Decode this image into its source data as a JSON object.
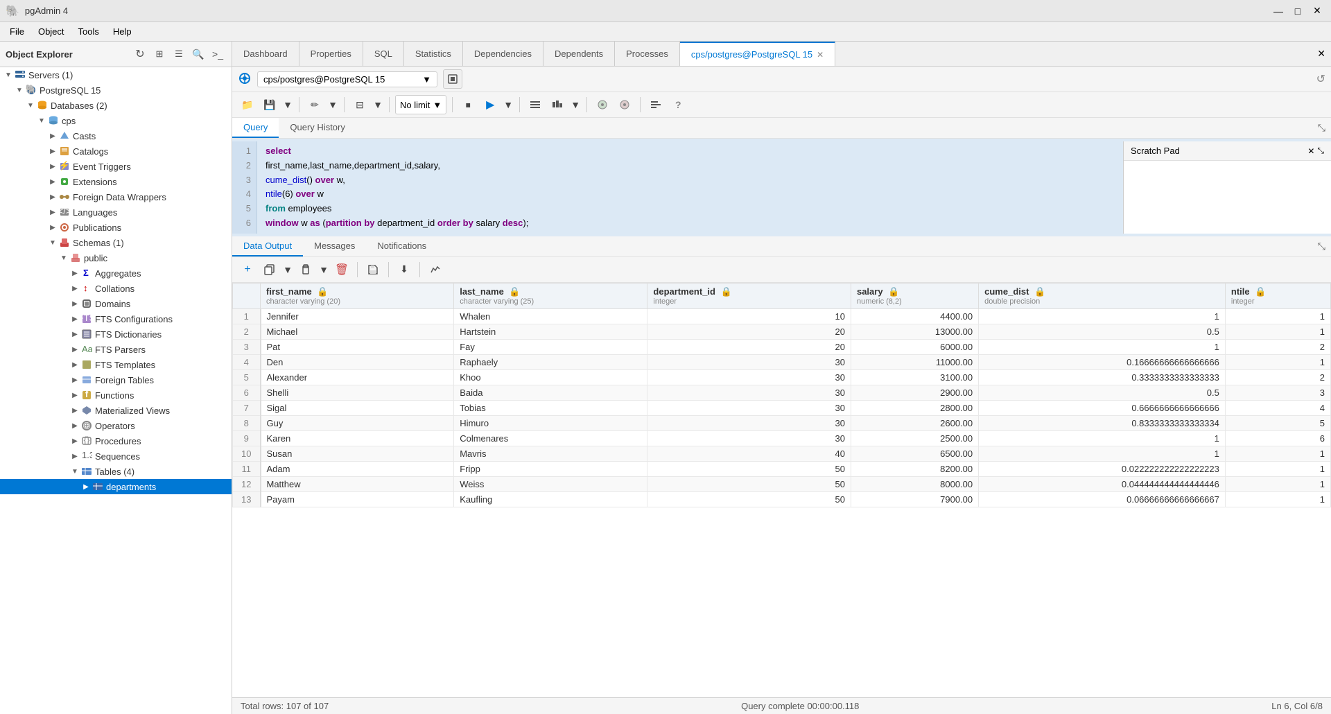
{
  "app": {
    "title": "pgAdmin 4",
    "icon": "🐘"
  },
  "window_controls": {
    "minimize": "—",
    "maximize": "□",
    "close": "✕"
  },
  "menu": {
    "items": [
      "File",
      "Object",
      "Tools",
      "Help"
    ]
  },
  "sidebar": {
    "title": "Object Explorer",
    "toolbar_buttons": [
      "refresh",
      "table-view",
      "columns",
      "search",
      "terminal"
    ],
    "tree": [
      {
        "level": 0,
        "label": "Servers (1)",
        "icon": "server",
        "expanded": true,
        "id": "servers"
      },
      {
        "level": 1,
        "label": "PostgreSQL 15",
        "icon": "pg",
        "expanded": true,
        "id": "pg15"
      },
      {
        "level": 2,
        "label": "Databases (2)",
        "icon": "db",
        "expanded": true,
        "id": "databases"
      },
      {
        "level": 3,
        "label": "cps",
        "icon": "db-single",
        "expanded": true,
        "id": "cps"
      },
      {
        "level": 4,
        "label": "Casts",
        "icon": "cast",
        "expanded": false,
        "id": "casts"
      },
      {
        "level": 4,
        "label": "Catalogs",
        "icon": "catalog",
        "expanded": false,
        "id": "catalogs"
      },
      {
        "level": 4,
        "label": "Event Triggers",
        "icon": "trigger",
        "expanded": false,
        "id": "event-triggers"
      },
      {
        "level": 4,
        "label": "Extensions",
        "icon": "ext",
        "expanded": false,
        "id": "extensions"
      },
      {
        "level": 4,
        "label": "Foreign Data Wrappers",
        "icon": "fdw",
        "expanded": false,
        "id": "fdw"
      },
      {
        "level": 4,
        "label": "Languages",
        "icon": "lang",
        "expanded": false,
        "id": "languages"
      },
      {
        "level": 4,
        "label": "Publications",
        "icon": "pub",
        "expanded": false,
        "id": "publications"
      },
      {
        "level": 4,
        "label": "Schemas (1)",
        "icon": "schema",
        "expanded": true,
        "id": "schemas"
      },
      {
        "level": 5,
        "label": "public",
        "icon": "public",
        "expanded": true,
        "id": "public"
      },
      {
        "level": 6,
        "label": "Aggregates",
        "icon": "agg",
        "expanded": false,
        "id": "aggregates"
      },
      {
        "level": 6,
        "label": "Collations",
        "icon": "coll",
        "expanded": false,
        "id": "collations"
      },
      {
        "level": 6,
        "label": "Domains",
        "icon": "dom",
        "expanded": false,
        "id": "domains"
      },
      {
        "level": 6,
        "label": "FTS Configurations",
        "icon": "fts",
        "expanded": false,
        "id": "fts-config"
      },
      {
        "level": 6,
        "label": "FTS Dictionaries",
        "icon": "fts",
        "expanded": false,
        "id": "fts-dict"
      },
      {
        "level": 6,
        "label": "FTS Parsers",
        "icon": "fts",
        "expanded": false,
        "id": "fts-parsers"
      },
      {
        "level": 6,
        "label": "FTS Templates",
        "icon": "fts",
        "expanded": false,
        "id": "fts-templates"
      },
      {
        "level": 6,
        "label": "Foreign Tables",
        "icon": "table",
        "expanded": false,
        "id": "foreign-tables"
      },
      {
        "level": 6,
        "label": "Functions",
        "icon": "func",
        "expanded": false,
        "id": "functions"
      },
      {
        "level": 6,
        "label": "Materialized Views",
        "icon": "mat",
        "expanded": false,
        "id": "mat-views"
      },
      {
        "level": 6,
        "label": "Operators",
        "icon": "op",
        "expanded": false,
        "id": "operators"
      },
      {
        "level": 6,
        "label": "Procedures",
        "icon": "proc",
        "expanded": false,
        "id": "procedures"
      },
      {
        "level": 6,
        "label": "Sequences",
        "icon": "seq",
        "expanded": false,
        "id": "sequences"
      },
      {
        "level": 6,
        "label": "Tables (4)",
        "icon": "table",
        "expanded": true,
        "id": "tables"
      },
      {
        "level": 7,
        "label": "departments",
        "icon": "table-item",
        "expanded": false,
        "id": "departments",
        "selected": true
      }
    ]
  },
  "tabs": {
    "main_tabs": [
      {
        "label": "Dashboard",
        "active": false
      },
      {
        "label": "Properties",
        "active": false
      },
      {
        "label": "SQL",
        "active": false
      },
      {
        "label": "Statistics",
        "active": false
      },
      {
        "label": "Dependencies",
        "active": false
      },
      {
        "label": "Dependents",
        "active": false
      },
      {
        "label": "Processes",
        "active": false
      },
      {
        "label": "cps/postgres@PostgreSQL 15",
        "active": true,
        "closable": true
      }
    ]
  },
  "connection_bar": {
    "connection_label": "cps/postgres@PostgreSQL 15",
    "dropdown_arrow": "▼"
  },
  "query_toolbar": {
    "buttons": [
      {
        "name": "open-file",
        "icon": "📁",
        "title": "Open File"
      },
      {
        "name": "save-file",
        "icon": "💾",
        "title": "Save File"
      },
      {
        "name": "save-dropdown",
        "icon": "▼",
        "title": "Save Options"
      },
      {
        "name": "edit-options",
        "icon": "✏",
        "title": "Edit"
      },
      {
        "name": "edit-dropdown",
        "icon": "▼",
        "title": "Edit Options"
      },
      {
        "name": "filter",
        "icon": "⊟",
        "title": "Filter"
      },
      {
        "name": "filter-dropdown",
        "icon": "▼",
        "title": "Filter Options"
      }
    ],
    "limit_label": "No limit",
    "limit_dropdown": "▼",
    "run_buttons": [
      {
        "name": "stop",
        "icon": "⏹",
        "title": "Stop"
      },
      {
        "name": "run",
        "icon": "▶",
        "title": "Execute/Refresh"
      },
      {
        "name": "run-dropdown",
        "icon": "▼",
        "title": "Run Options"
      },
      {
        "name": "explain",
        "icon": "☰",
        "title": "Explain"
      },
      {
        "name": "explain-analyze",
        "icon": "▮▮",
        "title": "Explain Analyze"
      },
      {
        "name": "explain-dropdown",
        "icon": "▼",
        "title": "Explain Options"
      }
    ],
    "other_buttons": [
      {
        "name": "commit",
        "icon": "✔",
        "title": "Commit"
      },
      {
        "name": "rollback",
        "icon": "↩",
        "title": "Rollback"
      },
      {
        "name": "format",
        "icon": "≡",
        "title": "Format"
      },
      {
        "name": "help",
        "icon": "?",
        "title": "Help"
      }
    ]
  },
  "query_editor": {
    "tabs": [
      "Query",
      "Query History"
    ],
    "active_tab": "Query",
    "lines": [
      {
        "num": 1,
        "code": "select",
        "type": "keyword"
      },
      {
        "num": 2,
        "code": "first_name,last_name,department_id,salary,",
        "type": "plain"
      },
      {
        "num": 3,
        "code": "cume_dist() over w,",
        "type": "mixed"
      },
      {
        "num": 4,
        "code": "ntile(6) over w",
        "type": "mixed"
      },
      {
        "num": 5,
        "code": "from employees",
        "type": "mixed"
      },
      {
        "num": 6,
        "code": "window w as  (partition by department_id order by salary desc);",
        "type": "mixed"
      }
    ]
  },
  "results": {
    "tabs": [
      "Data Output",
      "Messages",
      "Notifications"
    ],
    "active_tab": "Data Output",
    "columns": [
      {
        "name": "first_name",
        "type": "character varying (20)",
        "locked": true
      },
      {
        "name": "last_name",
        "type": "character varying (25)",
        "locked": true
      },
      {
        "name": "department_id",
        "type": "integer",
        "locked": true
      },
      {
        "name": "salary",
        "type": "numeric (8,2)",
        "locked": true
      },
      {
        "name": "cume_dist",
        "type": "double precision",
        "locked": true
      },
      {
        "name": "ntile",
        "type": "integer",
        "locked": true
      }
    ],
    "rows": [
      {
        "row": 1,
        "first_name": "Jennifer",
        "last_name": "Whalen",
        "department_id": 10,
        "salary": "4400.00",
        "cume_dist": "1",
        "ntile": 1
      },
      {
        "row": 2,
        "first_name": "Michael",
        "last_name": "Hartstein",
        "department_id": 20,
        "salary": "13000.00",
        "cume_dist": "0.5",
        "ntile": 1
      },
      {
        "row": 3,
        "first_name": "Pat",
        "last_name": "Fay",
        "department_id": 20,
        "salary": "6000.00",
        "cume_dist": "1",
        "ntile": 2
      },
      {
        "row": 4,
        "first_name": "Den",
        "last_name": "Raphaely",
        "department_id": 30,
        "salary": "11000.00",
        "cume_dist": "0.16666666666666666",
        "ntile": 1
      },
      {
        "row": 5,
        "first_name": "Alexander",
        "last_name": "Khoo",
        "department_id": 30,
        "salary": "3100.00",
        "cume_dist": "0.3333333333333333",
        "ntile": 2
      },
      {
        "row": 6,
        "first_name": "Shelli",
        "last_name": "Baida",
        "department_id": 30,
        "salary": "2900.00",
        "cume_dist": "0.5",
        "ntile": 3
      },
      {
        "row": 7,
        "first_name": "Sigal",
        "last_name": "Tobias",
        "department_id": 30,
        "salary": "2800.00",
        "cume_dist": "0.6666666666666666",
        "ntile": 4
      },
      {
        "row": 8,
        "first_name": "Guy",
        "last_name": "Himuro",
        "department_id": 30,
        "salary": "2600.00",
        "cume_dist": "0.8333333333333334",
        "ntile": 5
      },
      {
        "row": 9,
        "first_name": "Karen",
        "last_name": "Colmenares",
        "department_id": 30,
        "salary": "2500.00",
        "cume_dist": "1",
        "ntile": 6
      },
      {
        "row": 10,
        "first_name": "Susan",
        "last_name": "Mavris",
        "department_id": 40,
        "salary": "6500.00",
        "cume_dist": "1",
        "ntile": 1
      },
      {
        "row": 11,
        "first_name": "Adam",
        "last_name": "Fripp",
        "department_id": 50,
        "salary": "8200.00",
        "cume_dist": "0.022222222222222223",
        "ntile": 1
      },
      {
        "row": 12,
        "first_name": "Matthew",
        "last_name": "Weiss",
        "department_id": 50,
        "salary": "8000.00",
        "cume_dist": "0.044444444444444446",
        "ntile": 1
      },
      {
        "row": 13,
        "first_name": "Payam",
        "last_name": "Kaufling",
        "department_id": 50,
        "salary": "7900.00",
        "cume_dist": "0.06666666666666667",
        "ntile": 1
      }
    ],
    "total_rows": "Total rows: 107 of 107",
    "query_time": "Query complete 00:00:00.118"
  },
  "scratch_pad": {
    "title": "Scratch Pad"
  },
  "status_bar": {
    "position": "Ln 6, Col 6/8"
  }
}
